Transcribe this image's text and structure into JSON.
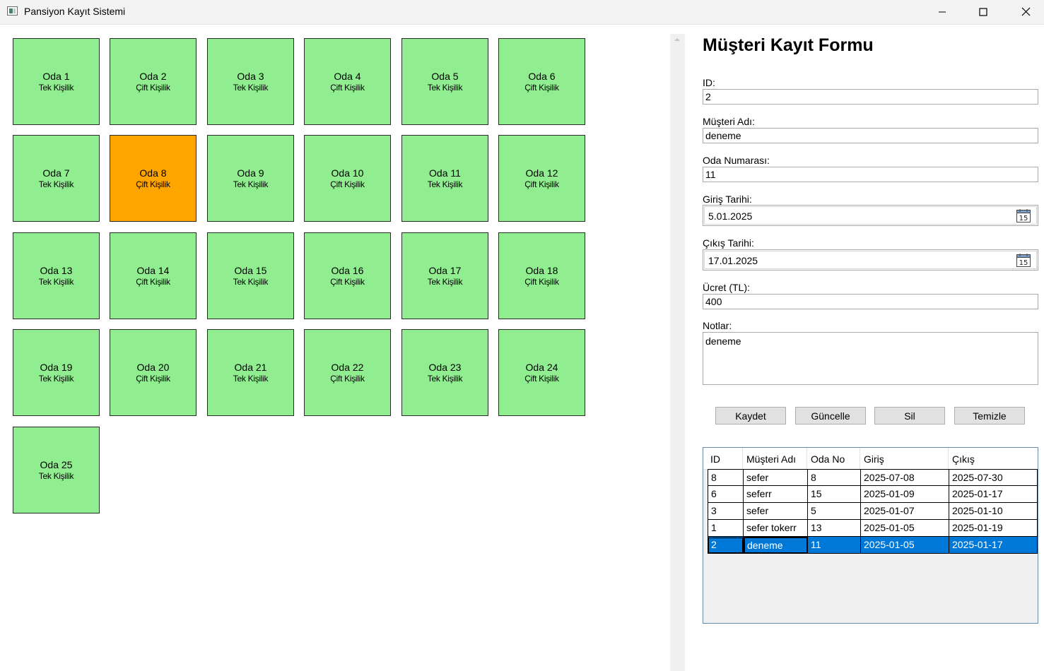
{
  "window": {
    "title": "Pansiyon Kayıt Sistemi",
    "controls": [
      "minimize-icon",
      "maximize-icon",
      "close-icon"
    ]
  },
  "rooms": [
    {
      "name": "Oda 1",
      "type": "Tek Kişilik",
      "status": "available"
    },
    {
      "name": "Oda 2",
      "type": "Çift Kişilik",
      "status": "available"
    },
    {
      "name": "Oda 3",
      "type": "Tek Kişilik",
      "status": "available"
    },
    {
      "name": "Oda 4",
      "type": "Çift Kişilik",
      "status": "available"
    },
    {
      "name": "Oda 5",
      "type": "Tek Kişilik",
      "status": "available"
    },
    {
      "name": "Oda 6",
      "type": "Çift Kişilik",
      "status": "available"
    },
    {
      "name": "Oda 7",
      "type": "Tek Kişilik",
      "status": "available"
    },
    {
      "name": "Oda 8",
      "type": "Çift Kişilik",
      "status": "occupied"
    },
    {
      "name": "Oda 9",
      "type": "Tek Kişilik",
      "status": "available"
    },
    {
      "name": "Oda 10",
      "type": "Çift Kişilik",
      "status": "available"
    },
    {
      "name": "Oda 11",
      "type": "Tek Kişilik",
      "status": "available"
    },
    {
      "name": "Oda 12",
      "type": "Çift Kişilik",
      "status": "available"
    },
    {
      "name": "Oda 13",
      "type": "Tek Kişilik",
      "status": "available"
    },
    {
      "name": "Oda 14",
      "type": "Çift Kişilik",
      "status": "available"
    },
    {
      "name": "Oda 15",
      "type": "Tek Kişilik",
      "status": "available"
    },
    {
      "name": "Oda 16",
      "type": "Çift Kişilik",
      "status": "available"
    },
    {
      "name": "Oda 17",
      "type": "Tek Kişilik",
      "status": "available"
    },
    {
      "name": "Oda 18",
      "type": "Çift Kişilik",
      "status": "available"
    },
    {
      "name": "Oda 19",
      "type": "Tek Kişilik",
      "status": "available"
    },
    {
      "name": "Oda 20",
      "type": "Çift Kişilik",
      "status": "available"
    },
    {
      "name": "Oda 21",
      "type": "Tek Kişilik",
      "status": "available"
    },
    {
      "name": "Oda 22",
      "type": "Çift Kişilik",
      "status": "available"
    },
    {
      "name": "Oda 23",
      "type": "Tek Kişilik",
      "status": "available"
    },
    {
      "name": "Oda 24",
      "type": "Çift Kişilik",
      "status": "available"
    },
    {
      "name": "Oda 25",
      "type": "Tek Kişilik",
      "status": "available"
    }
  ],
  "colors": {
    "available": "#90ee90",
    "occupied": "#ffa500",
    "selected_row": "#0078d7"
  },
  "form": {
    "title": "Müşteri Kayıt Formu",
    "id_label": "ID:",
    "id_value": "2",
    "name_label": "Müşteri Adı:",
    "name_value": "deneme",
    "room_label": "Oda Numarası:",
    "room_value": "11",
    "checkin_label": "Giriş Tarihi:",
    "checkin_value": "5.01.2025",
    "checkout_label": "Çıkış Tarihi:",
    "checkout_value": "17.01.2025",
    "fee_label": "Ücret (TL):",
    "fee_value": "400",
    "notes_label": "Notlar:",
    "notes_value": "deneme",
    "calendar_icon_text": "15"
  },
  "buttons": {
    "save": "Kaydet",
    "update": "Güncelle",
    "delete": "Sil",
    "clear": "Temizle"
  },
  "table": {
    "columns": [
      "ID",
      "Müşteri Adı",
      "Oda No",
      "Giriş",
      "Çıkış"
    ],
    "rows": [
      [
        "8",
        "sefer",
        "8",
        "2025-07-08",
        "2025-07-30"
      ],
      [
        "6",
        "seferr",
        "15",
        "2025-01-09",
        "2025-01-17"
      ],
      [
        "3",
        "sefer",
        "5",
        "2025-01-07",
        "2025-01-10"
      ],
      [
        "1",
        "sefer tokerr",
        "13",
        "2025-01-05",
        "2025-01-19"
      ],
      [
        "2",
        "deneme",
        "11",
        "2025-01-05",
        "2025-01-17"
      ]
    ],
    "selected_row": 4
  }
}
